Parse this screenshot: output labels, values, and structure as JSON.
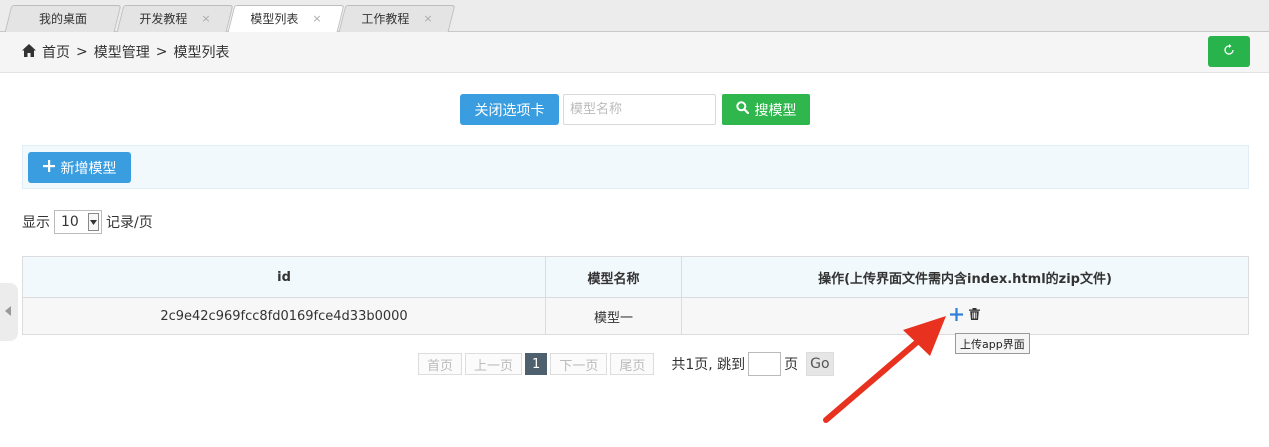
{
  "tabs": [
    {
      "label": "我的桌面",
      "closable": false
    },
    {
      "label": "开发教程",
      "closable": true
    },
    {
      "label": "模型列表",
      "closable": true,
      "active": true
    },
    {
      "label": "工作教程",
      "closable": true
    }
  ],
  "close_glyph": "×",
  "breadcrumb": {
    "home_icon": "home-icon",
    "items": [
      "首页",
      "模型管理",
      "模型列表"
    ],
    "separator": ">"
  },
  "refresh_icon": "refresh-icon",
  "search": {
    "close_tab_label": "关闭选项卡",
    "placeholder": "模型名称",
    "value": "",
    "search_label": "搜模型",
    "search_icon": "search-icon"
  },
  "toolbar": {
    "add_label": "新增模型",
    "add_icon": "plus-icon"
  },
  "page_size": {
    "prefix": "显示",
    "value": "10",
    "suffix": "记录/页"
  },
  "table": {
    "columns": [
      "id",
      "模型名称",
      "操作(上传界面文件需内含index.html的zip文件)"
    ],
    "rows": [
      {
        "id": "2c9e42c969fcc8fd0169fce4d33b0000",
        "name": "模型一",
        "actions": [
          "upload-plus-icon",
          "trash-icon"
        ]
      }
    ]
  },
  "tooltip": "上传app界面",
  "pagination": {
    "first": "首页",
    "prev": "上一页",
    "current": "1",
    "next": "下一页",
    "last": "尾页",
    "info_prefix": "共1页, 跳到",
    "info_suffix": "页",
    "go": "Go"
  },
  "colors": {
    "primary": "#3a9de0",
    "success": "#2fb64c",
    "annotation_arrow": "#e8321f",
    "pager_current": "#4e5f6e"
  }
}
